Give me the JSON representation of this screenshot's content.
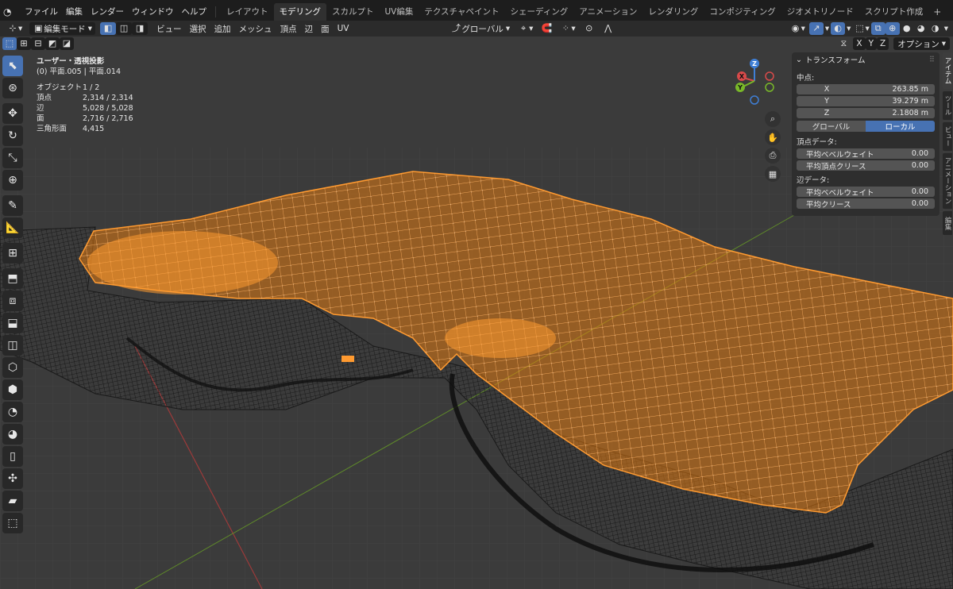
{
  "menubar": {
    "items": [
      "ファイル",
      "編集",
      "レンダー",
      "ウィンドウ",
      "ヘルプ"
    ],
    "workspaces": [
      "レイアウト",
      "モデリング",
      "スカルプト",
      "UV編集",
      "テクスチャペイント",
      "シェーディング",
      "アニメーション",
      "レンダリング",
      "コンポジティング",
      "ジオメトリノード",
      "スクリプト作成"
    ],
    "active_workspace": "モデリング",
    "add": "+"
  },
  "header": {
    "mode": "編集モード",
    "menus": [
      "ビュー",
      "選択",
      "追加",
      "メッシュ",
      "頂点",
      "辺",
      "面",
      "UV"
    ],
    "orientation": "グローバル",
    "axes": [
      "X",
      "Y",
      "Z"
    ],
    "options": "オプション"
  },
  "viewport": {
    "view_name": "ユーザー・透視投影",
    "object_line": "(0) 平面.005 | 平面.014",
    "stats": [
      {
        "label": "オブジェクト",
        "value": "1 / 2"
      },
      {
        "label": "頂点",
        "value": "2,314 / 2,314"
      },
      {
        "label": "辺",
        "value": "5,028 / 5,028"
      },
      {
        "label": "面",
        "value": "2,716 / 2,716"
      },
      {
        "label": "三角形面",
        "value": "4,415"
      }
    ],
    "gizmo": {
      "x": "X",
      "y": "Y",
      "z": "Z"
    }
  },
  "npanel": {
    "title": "トランスフォーム",
    "median_label": "中点:",
    "median": [
      {
        "axis": "X",
        "value": "263.85 m"
      },
      {
        "axis": "Y",
        "value": "39.279 m"
      },
      {
        "axis": "Z",
        "value": "2.1808 m"
      }
    ],
    "space_global": "グローバル",
    "space_local": "ローカル",
    "vertex_data_label": "頂点データ:",
    "vertex_data": [
      {
        "label": "平均ベベルウェイト",
        "value": "0.00"
      },
      {
        "label": "平均頂点クリース",
        "value": "0.00"
      }
    ],
    "edge_data_label": "辺データ:",
    "edge_data": [
      {
        "label": "平均ベベルウェイト",
        "value": "0.00"
      },
      {
        "label": "平均クリース",
        "value": "0.00"
      }
    ],
    "tabs": [
      "アイテム",
      "ツール",
      "ビュー",
      "アニメーション",
      "編集"
    ]
  },
  "colors": {
    "selected_mesh": "#ff8c1a",
    "accent": "#4772b3",
    "axis_x": "#d94a4a",
    "axis_y": "#79b829",
    "axis_z": "#3f7fd6"
  }
}
